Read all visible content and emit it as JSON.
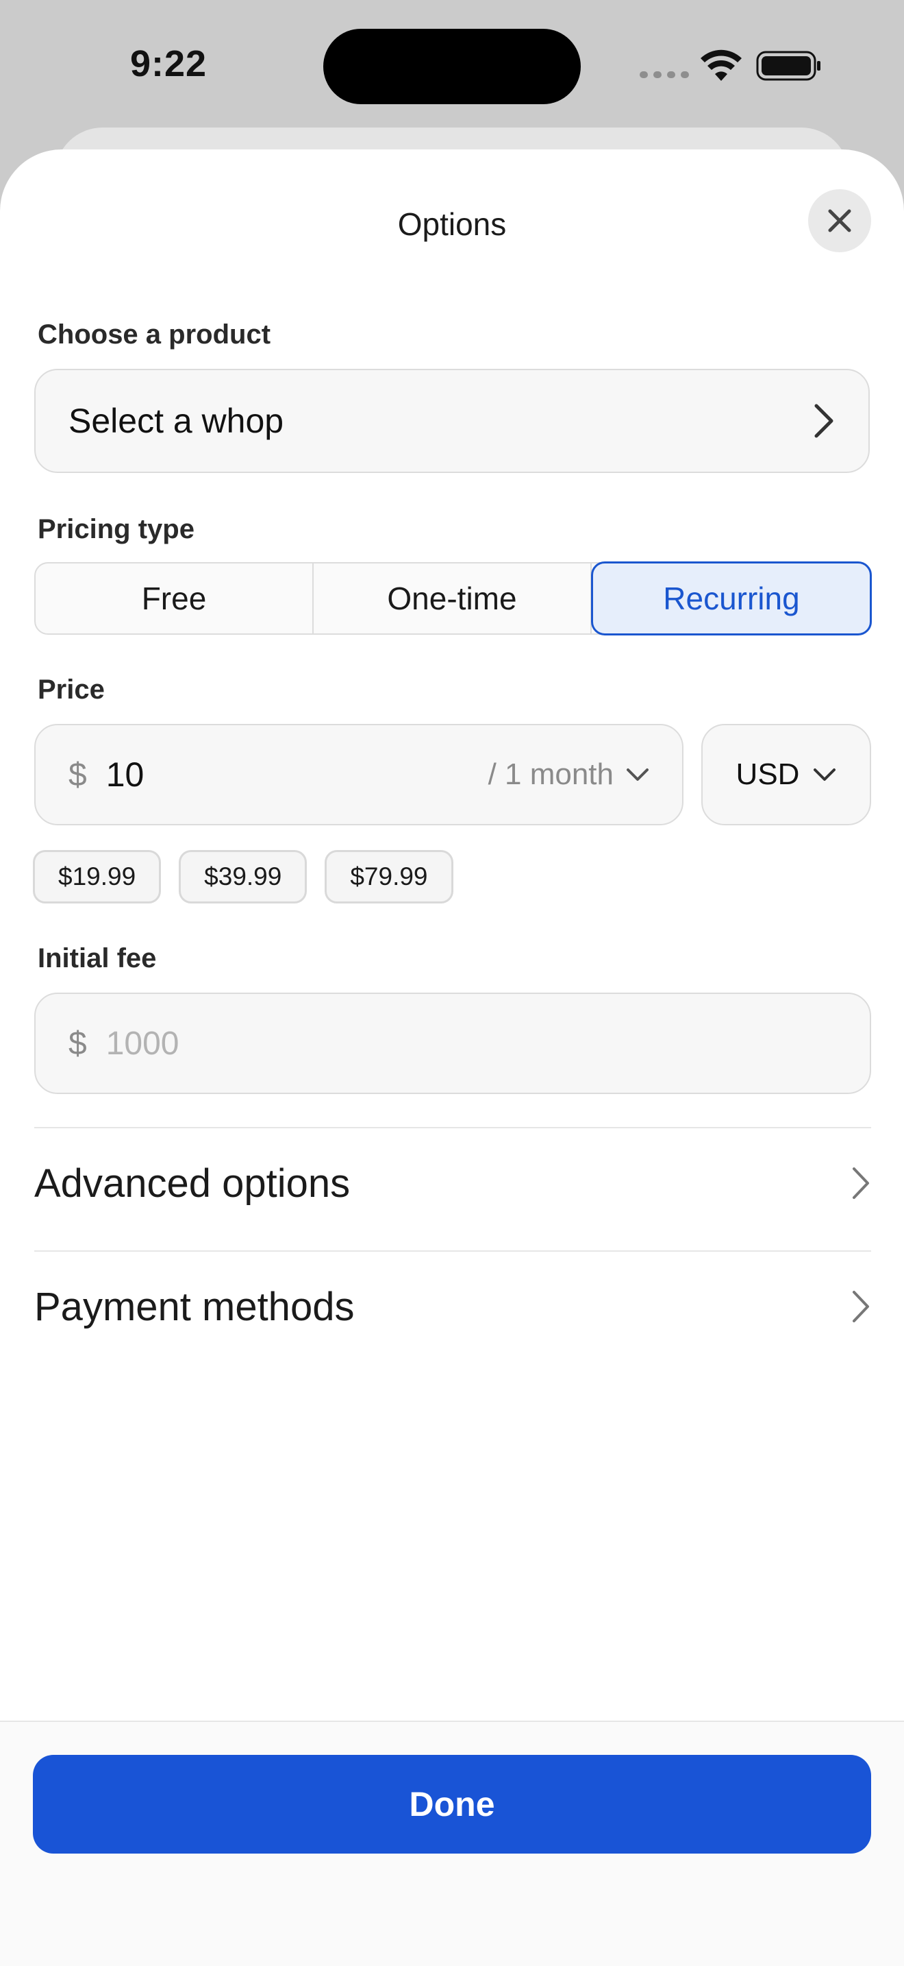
{
  "status_bar": {
    "time": "9:22"
  },
  "sheet": {
    "title": "Options",
    "product": {
      "label": "Choose a product",
      "value": "Select a whop"
    },
    "pricing_type": {
      "label": "Pricing type",
      "options": [
        "Free",
        "One-time",
        "Recurring"
      ],
      "selected": "Recurring"
    },
    "price": {
      "label": "Price",
      "currency_symbol": "$",
      "value": "10",
      "period": "/ 1 month",
      "currency": "USD",
      "quick_amounts": [
        "$19.99",
        "$39.99",
        "$79.99"
      ]
    },
    "initial_fee": {
      "label": "Initial fee",
      "currency_symbol": "$",
      "placeholder": "1000"
    },
    "rows": {
      "advanced": "Advanced options",
      "payment": "Payment methods"
    },
    "done_label": "Done"
  },
  "colors": {
    "accent": "#1954d6",
    "selected_bg": "#e6eefb",
    "field_bg": "#f7f7f7"
  }
}
